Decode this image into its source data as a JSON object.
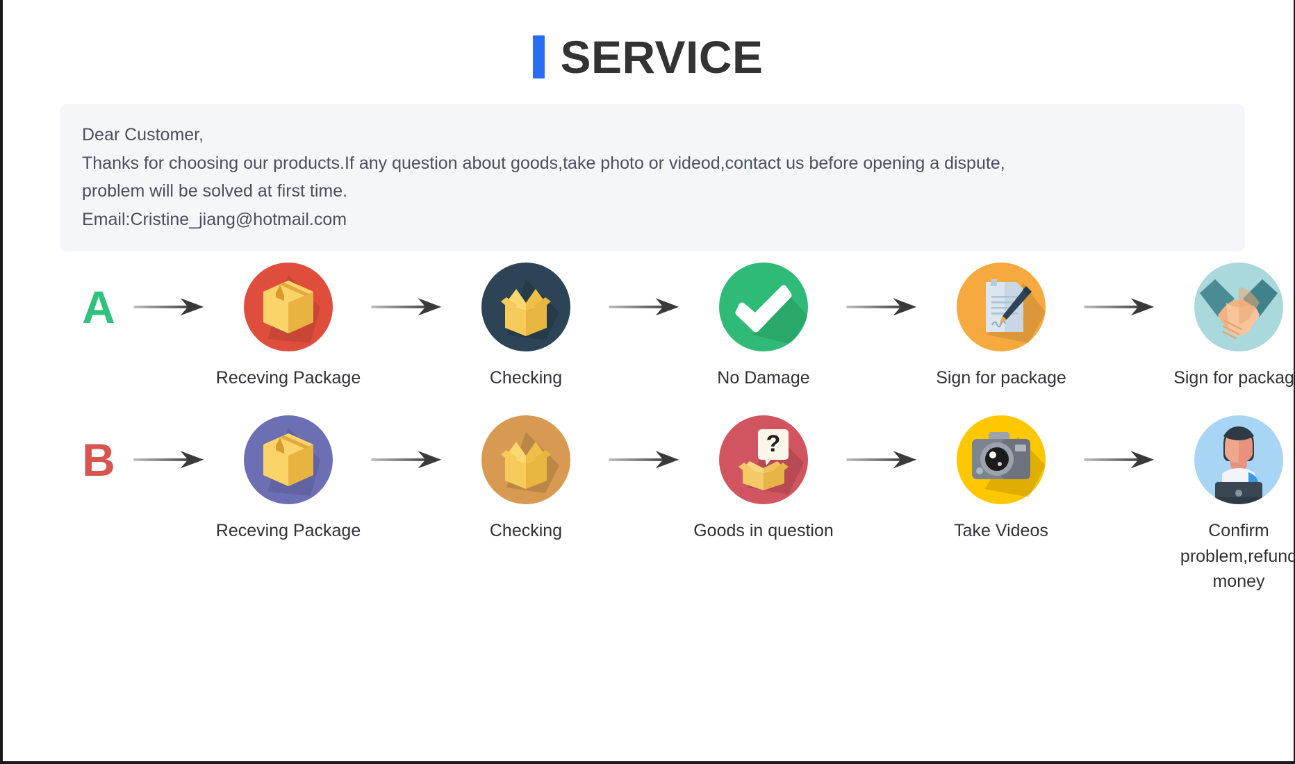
{
  "header": {
    "accent_color": "#2a6df4",
    "title": "SERVICE"
  },
  "notice": {
    "line1": "Dear Customer,",
    "line2": "Thanks for choosing our products.If any question about goods,take photo or videod,contact us before opening a dispute,",
    "line3": "problem will be solved at first time.",
    "line4": "Email:Cristine_jiang@hotmail.com"
  },
  "rows": [
    {
      "badge": "A",
      "badge_color": "#2ec27e",
      "arrow": "arrow-right-icon",
      "steps": [
        {
          "label": "Receving Package",
          "icon": "closed-package-box-icon",
          "circle_color": "#DF4E3C"
        },
        {
          "label": "Checking",
          "icon": "open-package-box-icon",
          "circle_color": "#2C4456"
        },
        {
          "label": "No Damage",
          "icon": "check-mark-icon",
          "circle_color": "#2BB673"
        },
        {
          "label": "Sign for package",
          "icon": "document-pen-sign-icon",
          "circle_color": "#F5A93F"
        },
        {
          "label": "Sign for package",
          "icon": "handshake-icon",
          "circle_color": "#A9D8DD"
        }
      ]
    },
    {
      "badge": "B",
      "badge_color": "#D9534F",
      "arrow": "arrow-right-icon",
      "steps": [
        {
          "label": "Receving Package",
          "icon": "closed-package-box-icon",
          "circle_color": "#6D6FB5"
        },
        {
          "label": "Checking",
          "icon": "open-package-box-icon",
          "circle_color": "#D89A52"
        },
        {
          "label": "Goods in question",
          "icon": "question-box-icon",
          "circle_color": "#D15560"
        },
        {
          "label": "Take Videos",
          "icon": "camera-icon",
          "circle_color": "#FFC700"
        },
        {
          "label": "Confirm problem,refund money",
          "icon": "support-agent-person-icon",
          "circle_color": "#A8D4F5"
        }
      ]
    }
  ]
}
